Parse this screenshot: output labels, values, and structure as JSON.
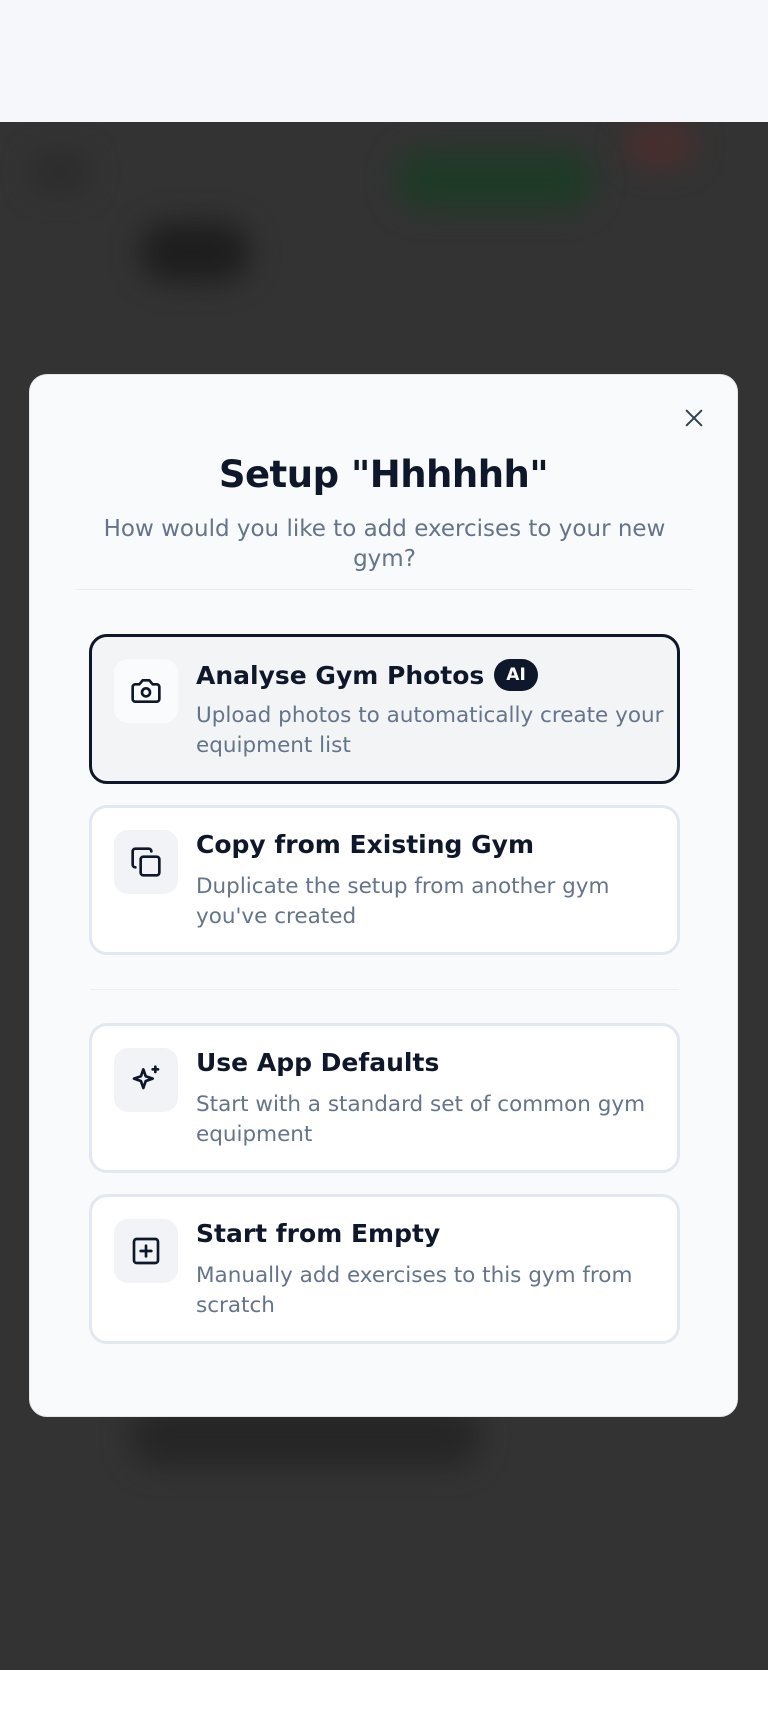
{
  "modal": {
    "title": "Setup \"Hhhhhh\"",
    "subtitle": "How would you like to add exercises to your new gym?",
    "close_icon": "close-icon",
    "options": [
      {
        "title": "Analyse Gym Photos",
        "badge": "AI",
        "description": "Upload photos to automatically create your equipment list",
        "icon": "camera-icon",
        "selected": true
      },
      {
        "title": "Copy from Existing Gym",
        "description": "Duplicate the setup from another gym you've created",
        "icon": "copy-icon",
        "selected": false
      },
      {
        "title": "Use App Defaults",
        "description": "Start with a standard set of common gym equipment",
        "icon": "sparkles-icon",
        "selected": false
      },
      {
        "title": "Start from Empty",
        "description": "Manually add exercises to this gym from scratch",
        "icon": "plus-square-icon",
        "selected": false
      }
    ]
  },
  "colors": {
    "overlay": "#333333",
    "modal_bg": "#f9fafb",
    "text_primary": "#0f172a",
    "text_secondary": "#64748b",
    "selected_border": "#0f172a",
    "option_border": "#e2e8f0"
  }
}
